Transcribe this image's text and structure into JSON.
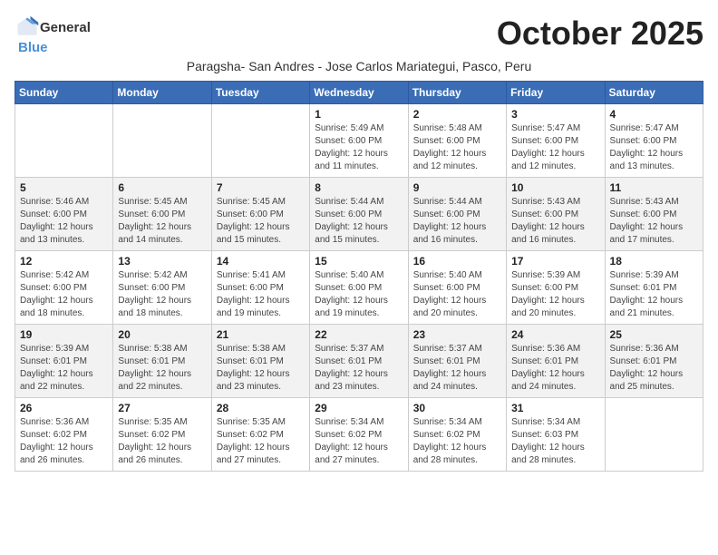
{
  "header": {
    "logo_general": "General",
    "logo_blue": "Blue",
    "month_title": "October 2025",
    "subtitle": "Paragsha- San Andres - Jose Carlos Mariategui, Pasco, Peru"
  },
  "weekdays": [
    "Sunday",
    "Monday",
    "Tuesday",
    "Wednesday",
    "Thursday",
    "Friday",
    "Saturday"
  ],
  "weeks": [
    [
      {
        "day": "",
        "info": ""
      },
      {
        "day": "",
        "info": ""
      },
      {
        "day": "",
        "info": ""
      },
      {
        "day": "1",
        "info": "Sunrise: 5:49 AM\nSunset: 6:00 PM\nDaylight: 12 hours and 11 minutes."
      },
      {
        "day": "2",
        "info": "Sunrise: 5:48 AM\nSunset: 6:00 PM\nDaylight: 12 hours and 12 minutes."
      },
      {
        "day": "3",
        "info": "Sunrise: 5:47 AM\nSunset: 6:00 PM\nDaylight: 12 hours and 12 minutes."
      },
      {
        "day": "4",
        "info": "Sunrise: 5:47 AM\nSunset: 6:00 PM\nDaylight: 12 hours and 13 minutes."
      }
    ],
    [
      {
        "day": "5",
        "info": "Sunrise: 5:46 AM\nSunset: 6:00 PM\nDaylight: 12 hours and 13 minutes."
      },
      {
        "day": "6",
        "info": "Sunrise: 5:45 AM\nSunset: 6:00 PM\nDaylight: 12 hours and 14 minutes."
      },
      {
        "day": "7",
        "info": "Sunrise: 5:45 AM\nSunset: 6:00 PM\nDaylight: 12 hours and 15 minutes."
      },
      {
        "day": "8",
        "info": "Sunrise: 5:44 AM\nSunset: 6:00 PM\nDaylight: 12 hours and 15 minutes."
      },
      {
        "day": "9",
        "info": "Sunrise: 5:44 AM\nSunset: 6:00 PM\nDaylight: 12 hours and 16 minutes."
      },
      {
        "day": "10",
        "info": "Sunrise: 5:43 AM\nSunset: 6:00 PM\nDaylight: 12 hours and 16 minutes."
      },
      {
        "day": "11",
        "info": "Sunrise: 5:43 AM\nSunset: 6:00 PM\nDaylight: 12 hours and 17 minutes."
      }
    ],
    [
      {
        "day": "12",
        "info": "Sunrise: 5:42 AM\nSunset: 6:00 PM\nDaylight: 12 hours and 18 minutes."
      },
      {
        "day": "13",
        "info": "Sunrise: 5:42 AM\nSunset: 6:00 PM\nDaylight: 12 hours and 18 minutes."
      },
      {
        "day": "14",
        "info": "Sunrise: 5:41 AM\nSunset: 6:00 PM\nDaylight: 12 hours and 19 minutes."
      },
      {
        "day": "15",
        "info": "Sunrise: 5:40 AM\nSunset: 6:00 PM\nDaylight: 12 hours and 19 minutes."
      },
      {
        "day": "16",
        "info": "Sunrise: 5:40 AM\nSunset: 6:00 PM\nDaylight: 12 hours and 20 minutes."
      },
      {
        "day": "17",
        "info": "Sunrise: 5:39 AM\nSunset: 6:00 PM\nDaylight: 12 hours and 20 minutes."
      },
      {
        "day": "18",
        "info": "Sunrise: 5:39 AM\nSunset: 6:01 PM\nDaylight: 12 hours and 21 minutes."
      }
    ],
    [
      {
        "day": "19",
        "info": "Sunrise: 5:39 AM\nSunset: 6:01 PM\nDaylight: 12 hours and 22 minutes."
      },
      {
        "day": "20",
        "info": "Sunrise: 5:38 AM\nSunset: 6:01 PM\nDaylight: 12 hours and 22 minutes."
      },
      {
        "day": "21",
        "info": "Sunrise: 5:38 AM\nSunset: 6:01 PM\nDaylight: 12 hours and 23 minutes."
      },
      {
        "day": "22",
        "info": "Sunrise: 5:37 AM\nSunset: 6:01 PM\nDaylight: 12 hours and 23 minutes."
      },
      {
        "day": "23",
        "info": "Sunrise: 5:37 AM\nSunset: 6:01 PM\nDaylight: 12 hours and 24 minutes."
      },
      {
        "day": "24",
        "info": "Sunrise: 5:36 AM\nSunset: 6:01 PM\nDaylight: 12 hours and 24 minutes."
      },
      {
        "day": "25",
        "info": "Sunrise: 5:36 AM\nSunset: 6:01 PM\nDaylight: 12 hours and 25 minutes."
      }
    ],
    [
      {
        "day": "26",
        "info": "Sunrise: 5:36 AM\nSunset: 6:02 PM\nDaylight: 12 hours and 26 minutes."
      },
      {
        "day": "27",
        "info": "Sunrise: 5:35 AM\nSunset: 6:02 PM\nDaylight: 12 hours and 26 minutes."
      },
      {
        "day": "28",
        "info": "Sunrise: 5:35 AM\nSunset: 6:02 PM\nDaylight: 12 hours and 27 minutes."
      },
      {
        "day": "29",
        "info": "Sunrise: 5:34 AM\nSunset: 6:02 PM\nDaylight: 12 hours and 27 minutes."
      },
      {
        "day": "30",
        "info": "Sunrise: 5:34 AM\nSunset: 6:02 PM\nDaylight: 12 hours and 28 minutes."
      },
      {
        "day": "31",
        "info": "Sunrise: 5:34 AM\nSunset: 6:03 PM\nDaylight: 12 hours and 28 minutes."
      },
      {
        "day": "",
        "info": ""
      }
    ]
  ]
}
